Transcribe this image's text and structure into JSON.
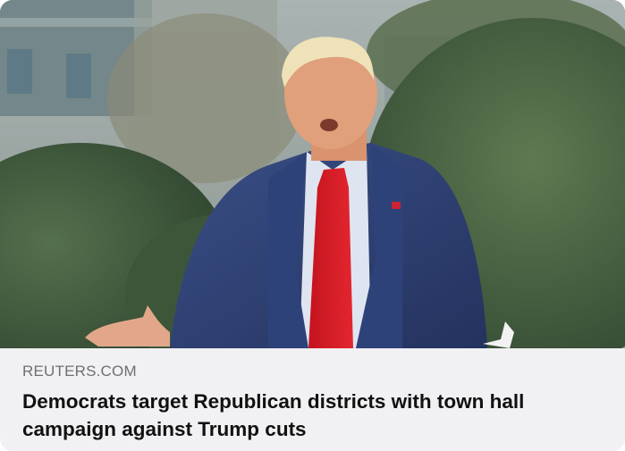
{
  "link_preview": {
    "image_description_icon": "news-photo",
    "source": "REUTERS.COM",
    "headline": "Democrats target Republican districts with town hall campaign against Trump cuts"
  }
}
